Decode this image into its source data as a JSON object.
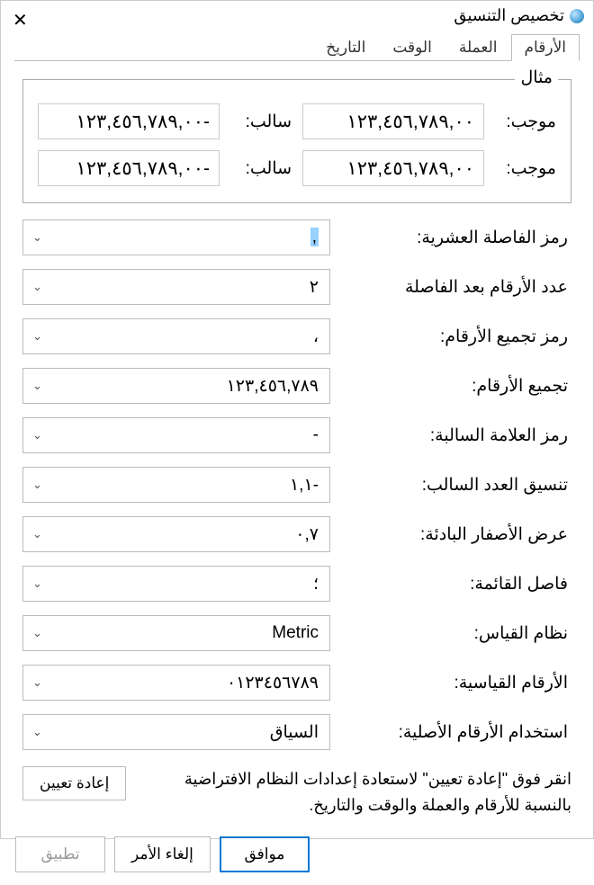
{
  "title": "تخصيص التنسيق",
  "tabs": {
    "numbers": "الأرقام",
    "currency": "العملة",
    "time": "الوقت",
    "date": "التاريخ"
  },
  "example": {
    "legend": "مثال",
    "pos_label": "موجب:",
    "neg_label": "سالب:",
    "pos_val_1": "١٢٣,٤٥٦,٧٨٩,٠٠",
    "neg_val_1": "١٢٣,٤٥٦,٧٨٩,٠٠-",
    "pos_val_2": "١٢٣,٤٥٦,٧٨٩,٠٠",
    "neg_val_2": "١٢٣,٤٥٦,٧٨٩,٠٠-"
  },
  "fields": {
    "decimal_symbol": {
      "label": "رمز الفاصلة العشرية:",
      "value": ","
    },
    "digits_after": {
      "label": "عدد الأرقام بعد الفاصلة",
      "value": "٢"
    },
    "grouping_symbol": {
      "label": "رمز تجميع الأرقام:",
      "value": "،"
    },
    "digit_grouping": {
      "label": "تجميع الأرقام:",
      "value": "١٢٣,٤٥٦,٧٨٩"
    },
    "negative_sign": {
      "label": "رمز العلامة السالبة:",
      "value": "-"
    },
    "negative_format": {
      "label": "تنسيق العدد السالب:",
      "value": "١,١-"
    },
    "leading_zeros": {
      "label": "عرض الأصفار البادئة:",
      "value": "٠,٧"
    },
    "list_separator": {
      "label": "فاصل القائمة:",
      "value": "؛"
    },
    "measurement": {
      "label": "نظام القياس:",
      "value": "Metric"
    },
    "standard_digits": {
      "label": "الأرقام القياسية:",
      "value": "٠١٢٣٤٥٦٧٨٩"
    },
    "native_digits": {
      "label": "استخدام الأرقام الأصلية:",
      "value": "السياق"
    }
  },
  "reset": {
    "text": "انقر فوق \"إعادة تعيين\" لاستعادة إعدادات النظام الافتراضية بالنسبة للأرقام والعملة والوقت والتاريخ.",
    "button": "إعادة تعيين"
  },
  "footer": {
    "ok": "موافق",
    "cancel": "إلغاء الأمر",
    "apply": "تطبيق"
  }
}
